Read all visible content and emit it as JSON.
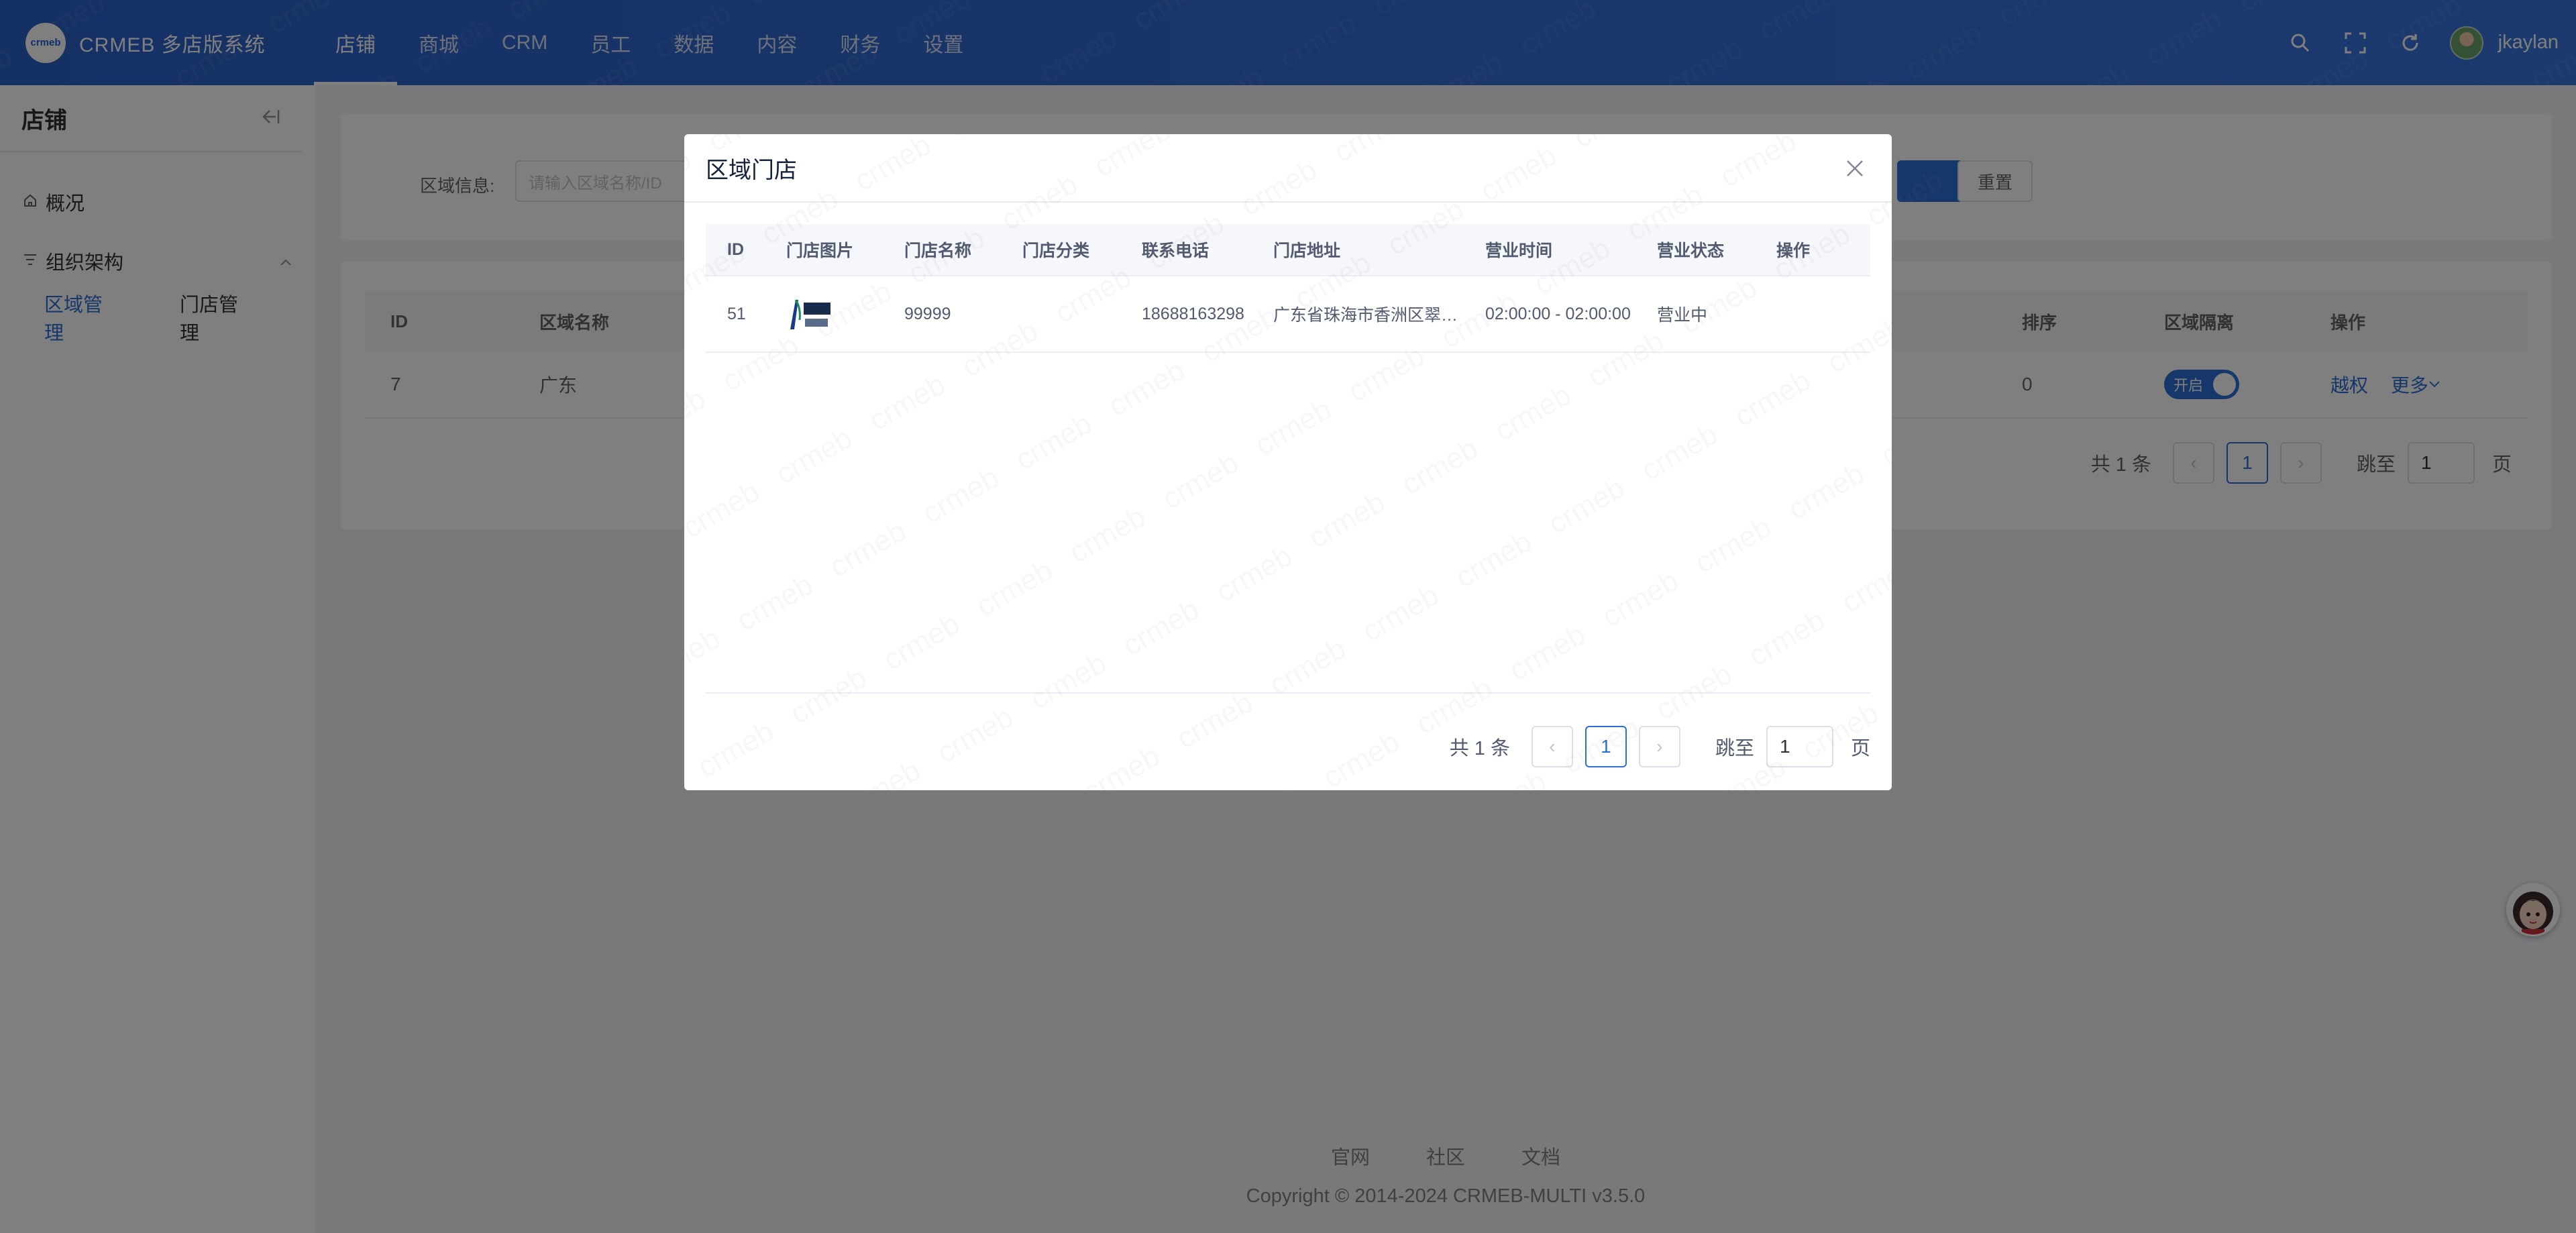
{
  "app": {
    "logo_text": "crmeb",
    "name": "CRMEB 多店版系统",
    "nav": [
      "店铺",
      "商城",
      "CRM",
      "员工",
      "数据",
      "内容",
      "财务",
      "设置"
    ],
    "active_nav": "店铺",
    "user": "jkaylan"
  },
  "sidebar": {
    "title": "店铺",
    "overview": "概况",
    "group": "组织架构",
    "sub_items": [
      "区域管理",
      "门店管理"
    ],
    "active_sub": "区域管理"
  },
  "filter": {
    "label": "区域信息:",
    "placeholder": "请输入区域名称/ID",
    "reset_label": "重置"
  },
  "region_table": {
    "headers": {
      "id": "ID",
      "name": "区域名称",
      "sort": "排序",
      "isolation": "区域隔离",
      "ops": "操作"
    },
    "row": {
      "id": "7",
      "name": "广东",
      "sort": "0",
      "switch": "开启",
      "op1": "越权",
      "op2": "更多"
    },
    "pager": {
      "total": "共 1 条",
      "current": "1",
      "jump_label": "跳至",
      "jump_value": "1",
      "page_unit": "页"
    }
  },
  "footer": {
    "links": [
      "官网",
      "社区",
      "文档"
    ],
    "copyright": "Copyright © 2014-2024 CRMEB-MULTI v3.5.0"
  },
  "dialog": {
    "title": "区域门店",
    "headers": {
      "id": "ID",
      "image": "门店图片",
      "name": "门店名称",
      "category": "门店分类",
      "phone": "联系电话",
      "address": "门店地址",
      "hours": "营业时间",
      "status": "营业状态",
      "ops": "操作"
    },
    "rows": [
      {
        "id": "51",
        "name": "99999",
        "category": "",
        "phone": "18688163298",
        "address": "广东省珠海市香洲区翠香街道",
        "hours": "02:00:00 - 02:00:00",
        "status": "营业中",
        "ops": ""
      }
    ],
    "pager": {
      "total": "共 1 条",
      "current": "1",
      "jump_label": "跳至",
      "jump_value": "1",
      "page_unit": "页"
    }
  },
  "watermark_text": "crmeb",
  "colors": {
    "primary": "#2d6ed4",
    "topbar": "#2b62c9"
  }
}
